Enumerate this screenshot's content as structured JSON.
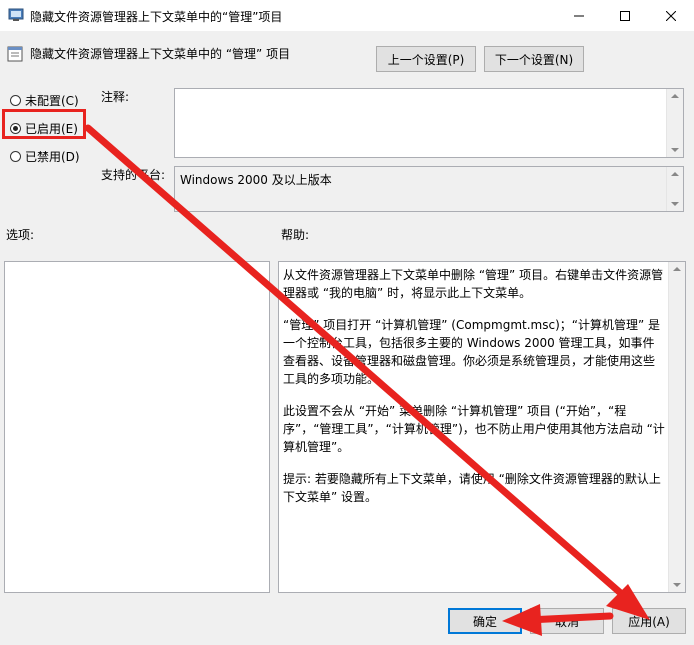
{
  "window": {
    "title": "隐藏文件资源管理器上下文菜单中的“管理”项目",
    "minimize_icon": "minimize-icon",
    "maximize_icon": "maximize-icon",
    "close_icon": "close-icon"
  },
  "header": {
    "policy_title": "隐藏文件资源管理器上下文菜单中的 “管理” 项目",
    "prev_setting": "上一个设置(P)",
    "next_setting": "下一个设置(N)"
  },
  "state": {
    "options": [
      {
        "label": "未配置(C)",
        "checked": false
      },
      {
        "label": "已启用(E)",
        "checked": true
      },
      {
        "label": "已禁用(D)",
        "checked": false
      }
    ]
  },
  "comment": {
    "label": "注释:",
    "value": ""
  },
  "platform": {
    "label": "支持的平台:",
    "value": "Windows 2000 及以上版本"
  },
  "options_section": {
    "label": "选项:"
  },
  "help_section": {
    "label": "帮助:",
    "paragraphs": [
      "从文件资源管理器上下文菜单中删除 “管理” 项目。右键单击文件资源管理器或 “我的电脑” 时，将显示此上下文菜单。",
      "“管理” 项目打开 “计算机管理” (Compmgmt.msc)；“计算机管理” 是一个控制台工具，包括很多主要的 Windows 2000 管理工具，如事件查看器、设备管理器和磁盘管理。你必须是系统管理员，才能使用这些工具的多项功能。",
      "此设置不会从 “开始” 菜单删除 “计算机管理” 项目 (“开始”，“程序”，“管理工具”，“计算机管理”)，也不防止用户使用其他方法启动 “计算机管理”。",
      "提示: 若要隐藏所有上下文菜单，请使用 “删除文件资源管理器的默认上下文菜单” 设置。"
    ]
  },
  "footer": {
    "ok": "确定",
    "cancel": "取消",
    "apply": "应用(A)"
  },
  "colors": {
    "annotation_red": "#e8231f",
    "focus_blue": "#0078d7"
  }
}
